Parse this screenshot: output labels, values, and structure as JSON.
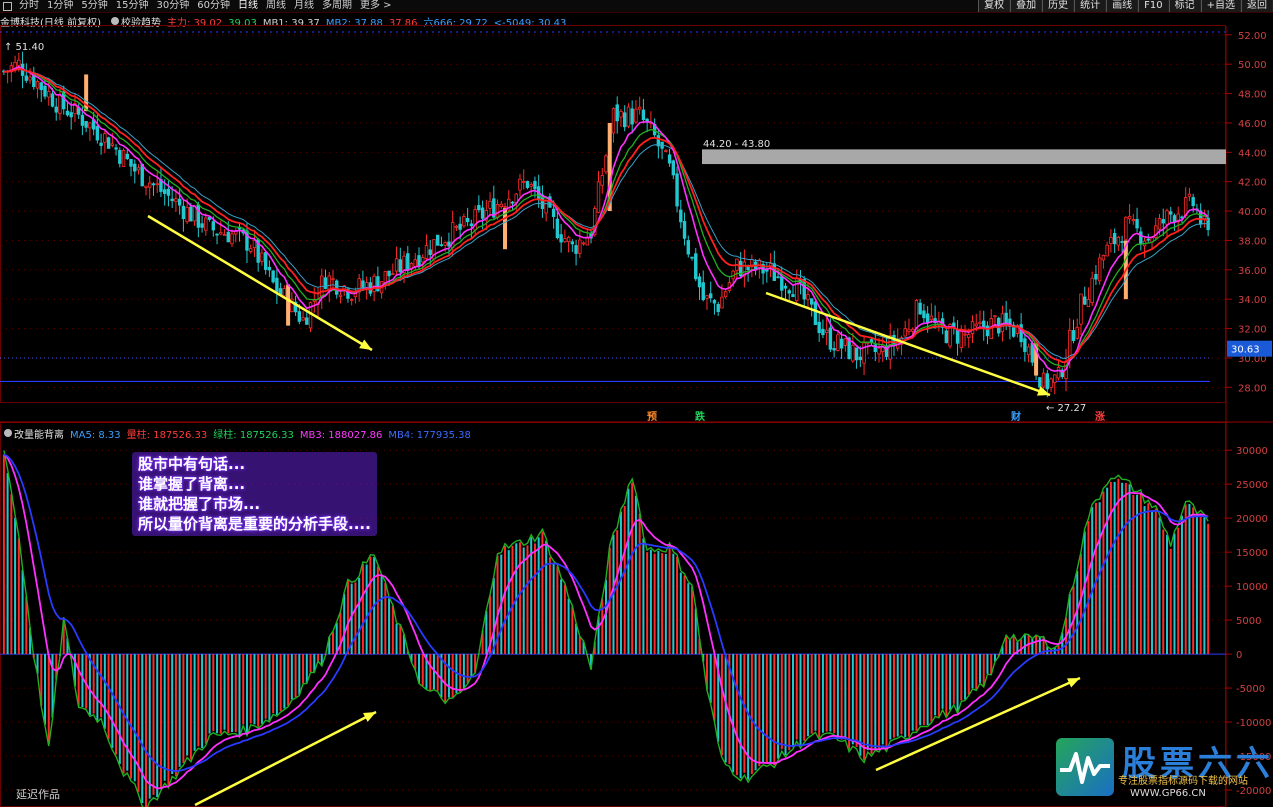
{
  "toolbar": {
    "periods": [
      "分时",
      "1分钟",
      "5分钟",
      "15分钟",
      "30分钟",
      "60分钟",
      "日线",
      "周线",
      "月线",
      "多周期",
      "更多 >"
    ],
    "active_period": "日线",
    "right_buttons": [
      "复权",
      "叠加",
      "历史",
      "统计",
      "画线",
      "F10",
      "标记",
      "+自选",
      "返回"
    ]
  },
  "main_info": {
    "stock_name": "金博科技(日线 前复权)",
    "indicator": "校验趋势",
    "items": [
      {
        "label": "主力: 39.02",
        "color": "#ff3b3b"
      },
      {
        "label": "39.03",
        "color": "#22d15a"
      },
      {
        "label": "MB1: 39.37",
        "color": "#d0d0d0"
      },
      {
        "label": "MB2: 37.88",
        "color": "#3aa0ff"
      },
      {
        "label": "37.86",
        "color": "#ff3b3b"
      },
      {
        "label": "六666: 29.72",
        "color": "#3aa0ff"
      },
      {
        "label": "<-5049: 30.43",
        "color": "#3aa0ff"
      }
    ]
  },
  "sub_info": {
    "indicator": "改量能背离",
    "items": [
      {
        "label": "MA5: 8.33",
        "color": "#3aa0ff"
      },
      {
        "label": "量柱: 187526.33",
        "color": "#ff3b3b"
      },
      {
        "label": "绿柱: 187526.33",
        "color": "#22d15a"
      },
      {
        "label": "MB3: 188027.86",
        "color": "#ff3bff"
      },
      {
        "label": "MB4: 177935.38",
        "color": "#3a6bff"
      }
    ]
  },
  "price_axis": [
    "52.00",
    "50.00",
    "48.00",
    "46.00",
    "44.00",
    "42.00",
    "40.00",
    "38.00",
    "36.00",
    "34.00",
    "32.00",
    "30.00",
    "28.00"
  ],
  "price_current": "30.63",
  "volume_axis": [
    "30000",
    "25000",
    "20000",
    "15000",
    "10000",
    "5000",
    "0",
    "-5000",
    "-10000",
    "-15000",
    "-20000"
  ],
  "annotations": {
    "high_label": "↑ 51.40",
    "low_label": "← 27.27",
    "resistance_label": "44.20 - 43.80",
    "markers": [
      {
        "text": "预",
        "color": "#ff8a2b"
      },
      {
        "text": "跌",
        "color": "#22d15a"
      },
      {
        "text": "财",
        "color": "#3aa0ff"
      },
      {
        "text": "涨",
        "color": "#ff3b3b"
      }
    ]
  },
  "overlay_lines": [
    "股市中有句话...",
    "谁掌握了背离...",
    "谁就把握了市场...",
    "所以量价背离是重要的分析手段...."
  ],
  "footer_label": "延迟作品",
  "logo": {
    "title": "股票六六",
    "subtitle": "专注股票指标源码下载的网站",
    "url": "WWW.GP66.CN"
  },
  "colors": {
    "up": "#ff2a2a",
    "down": "#22c8d0",
    "ma_red": "#ff2020",
    "ma_green": "#20b020",
    "ma_cyan": "#3aa0c8",
    "ma_magenta": "#ff30ff",
    "ma_blue": "#2a3aff",
    "arrow": "#ffff40",
    "grid": "#5a0000"
  },
  "chart_data": {
    "type": "candlestick",
    "ylim": [
      27.0,
      52.6
    ],
    "volume_ylim": [
      -22500,
      31500
    ],
    "note_x": "days",
    "price_keypoints": [
      [
        0,
        49.5
      ],
      [
        4,
        50.0
      ],
      [
        10,
        48.5
      ],
      [
        15,
        47.2
      ],
      [
        20,
        46.5
      ],
      [
        28,
        44.8
      ],
      [
        35,
        42.8
      ],
      [
        45,
        40.8
      ],
      [
        55,
        38.8
      ],
      [
        60,
        38.5
      ],
      [
        66,
        37.8
      ],
      [
        72,
        35.0
      ],
      [
        80,
        32.6
      ],
      [
        86,
        35.5
      ],
      [
        93,
        34.6
      ],
      [
        100,
        35.2
      ],
      [
        108,
        36.5
      ],
      [
        116,
        38.0
      ],
      [
        124,
        39.0
      ],
      [
        132,
        40.5
      ],
      [
        140,
        42.0
      ],
      [
        146,
        39.5
      ],
      [
        152,
        37.5
      ],
      [
        157,
        38.6
      ],
      [
        163,
        46.5
      ],
      [
        170,
        46.5
      ],
      [
        174,
        45.0
      ],
      [
        178,
        42.8
      ],
      [
        183,
        37.5
      ],
      [
        187,
        34.0
      ],
      [
        191,
        33.6
      ],
      [
        196,
        36.2
      ],
      [
        204,
        36.0
      ],
      [
        212,
        34.8
      ],
      [
        220,
        31.4
      ],
      [
        228,
        30.2
      ],
      [
        235,
        30.5
      ],
      [
        240,
        31.4
      ],
      [
        245,
        33.6
      ],
      [
        250,
        31.8
      ],
      [
        257,
        31.5
      ],
      [
        265,
        32.4
      ],
      [
        272,
        31.8
      ],
      [
        278,
        28.2
      ],
      [
        282,
        28.6
      ],
      [
        288,
        33.6
      ],
      [
        294,
        37.0
      ],
      [
        300,
        39.0
      ],
      [
        306,
        38.2
      ],
      [
        312,
        39.8
      ],
      [
        318,
        40.5
      ],
      [
        322,
        38.3
      ]
    ],
    "volume_keypoints": [
      [
        0,
        30000
      ],
      [
        4,
        17000
      ],
      [
        8,
        0
      ],
      [
        12,
        -14000
      ],
      [
        16,
        5000
      ],
      [
        20,
        -7500
      ],
      [
        26,
        -9500
      ],
      [
        32,
        -17000
      ],
      [
        38,
        -22000
      ],
      [
        45,
        -18000
      ],
      [
        55,
        -12000
      ],
      [
        65,
        -11000
      ],
      [
        75,
        -8000
      ],
      [
        85,
        -1000
      ],
      [
        92,
        10000
      ],
      [
        99,
        14500
      ],
      [
        105,
        5000
      ],
      [
        112,
        -5000
      ],
      [
        120,
        -7000
      ],
      [
        126,
        -3000
      ],
      [
        132,
        15000
      ],
      [
        138,
        16000
      ],
      [
        144,
        17500
      ],
      [
        150,
        10000
      ],
      [
        157,
        -2000
      ],
      [
        162,
        15000
      ],
      [
        168,
        26000
      ],
      [
        172,
        15000
      ],
      [
        178,
        15500
      ],
      [
        184,
        10000
      ],
      [
        188,
        -5000
      ],
      [
        192,
        -15500
      ],
      [
        198,
        -18000
      ],
      [
        205,
        -16000
      ],
      [
        215,
        -12000
      ],
      [
        222,
        -12000
      ],
      [
        230,
        -15000
      ],
      [
        238,
        -13000
      ],
      [
        246,
        -10000
      ],
      [
        256,
        -7500
      ],
      [
        264,
        -3000
      ],
      [
        268,
        3000
      ],
      [
        272,
        2000
      ],
      [
        276,
        2500
      ],
      [
        282,
        1000
      ],
      [
        290,
        20000
      ],
      [
        296,
        26000
      ],
      [
        302,
        24000
      ],
      [
        308,
        21000
      ],
      [
        312,
        16000
      ],
      [
        316,
        22000
      ],
      [
        322,
        19000
      ]
    ]
  }
}
